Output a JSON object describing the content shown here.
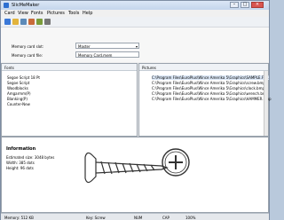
{
  "window": {
    "title": "SlicMeMaker"
  },
  "menubar": [
    "Card",
    "View",
    "Fonts",
    "Pictures",
    "Tools",
    "Help"
  ],
  "options": {
    "card_label": "Memory card slot:",
    "card_value": "Master",
    "file_label": "Memory card file:",
    "file_value": "Memory Card.mem"
  },
  "fonts": {
    "header": "Fonts",
    "items": [
      "Segoe Script 18 Pt",
      "Segoe Script",
      "Woodblocks",
      "Amgarmm(P)",
      "Blanking(P)",
      "Counter-New"
    ]
  },
  "pictures": {
    "header": "Pictures",
    "items": [
      "C:\\Program Files\\EuroPlus\\Wince Amerika 5\\Graphics\\SAMPLE.FCC",
      "C:\\Program Files\\EuroPlus\\Wince Amerika 5\\Graphics\\screw.bmp",
      "C:\\Program Files\\EuroPlus\\Wince Amerika 5\\Graphics\\clock.bmp",
      "C:\\Program Files\\EuroPlus\\Wince Amerika 5\\Graphics\\wrench.bmp",
      "C:\\Program Files\\EuroPlus\\Wince Amerika 5\\Graphics\\HAMMER.bmp"
    ]
  },
  "info": {
    "title": "Information",
    "size": "Estimated size: 3048 bytes",
    "width": "Width: 385 dots",
    "height": "Height: 96 dots"
  },
  "status": {
    "memory": "Memory: 512 KB",
    "mode": "Key: Screw",
    "num": "NUM",
    "caps": "CAP",
    "zoom": "100%"
  },
  "colors": {
    "accent": "#2d6fd0",
    "selection": "#dbe7f6",
    "close": "#d9554f"
  }
}
